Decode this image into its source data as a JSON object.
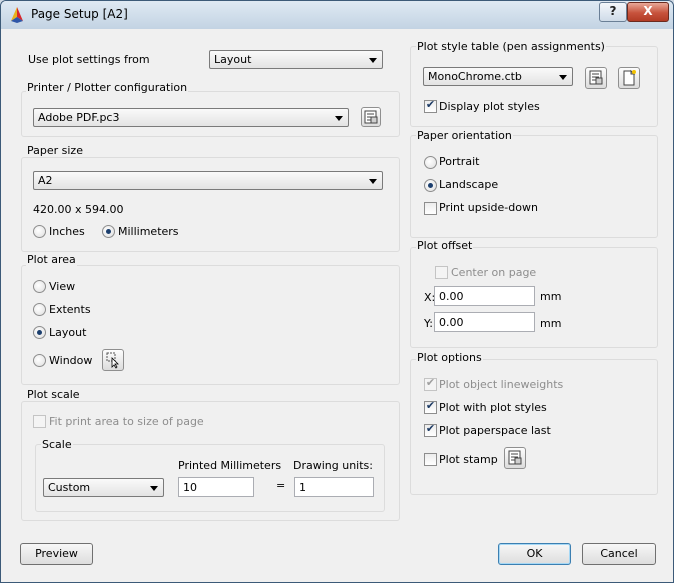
{
  "window": {
    "title": "Page Setup [A2]",
    "help_glyph": "?",
    "close_glyph": "X"
  },
  "plot_settings": {
    "label": "Use plot settings from",
    "value": "Layout"
  },
  "printer": {
    "group_label": "Printer / Plotter configuration",
    "value": "Adobe PDF.pc3"
  },
  "paper_size": {
    "group_label": "Paper size",
    "value": "A2",
    "dimensions": "420.00 x 594.00",
    "inches_label": "Inches",
    "mm_label": "Millimeters",
    "selected_unit": "Millimeters"
  },
  "plot_area": {
    "group_label": "Plot area",
    "options": [
      "View",
      "Extents",
      "Layout",
      "Window"
    ],
    "selected": "Layout"
  },
  "plot_scale": {
    "group_label": "Plot scale",
    "fit_label": "Fit print area to size of page",
    "fit_checked": false,
    "scale_label": "Scale",
    "scale_value": "Custom",
    "printed_label": "Printed Millimeters",
    "printed_value": "10",
    "equals": "=",
    "drawing_label": "Drawing units:",
    "drawing_value": "1"
  },
  "plot_style_table": {
    "group_label": "Plot style table (pen assignments)",
    "value": "MonoChrome.ctb",
    "display_label": "Display plot styles",
    "display_checked": true
  },
  "orientation": {
    "group_label": "Paper orientation",
    "portrait_label": "Portrait",
    "landscape_label": "Landscape",
    "selected": "Landscape",
    "upside_label": "Print upside-down",
    "upside_checked": false
  },
  "plot_offset": {
    "group_label": "Plot offset",
    "center_label": "Center on page",
    "center_checked": false,
    "x_label": "X:",
    "x_value": "0.00",
    "x_unit": "mm",
    "y_label": "Y:",
    "y_value": "0.00",
    "y_unit": "mm"
  },
  "plot_options": {
    "group_label": "Plot options",
    "lineweights_label": "Plot object lineweights",
    "lineweights_checked": true,
    "styles_label": "Plot with plot styles",
    "styles_checked": true,
    "paperspace_label": "Plot paperspace last",
    "paperspace_checked": true,
    "stamp_label": "Plot stamp",
    "stamp_checked": false
  },
  "buttons": {
    "preview": "Preview",
    "ok": "OK",
    "cancel": "Cancel"
  },
  "check_glyph": "✔",
  "colors": {
    "titlebar_top": "#dfe9f3",
    "titlebar_bottom": "#c3d3e3",
    "dialog_bg": "#f0f0f0",
    "close_red": "#c7533c",
    "default_button_border": "#3c7fb1"
  }
}
